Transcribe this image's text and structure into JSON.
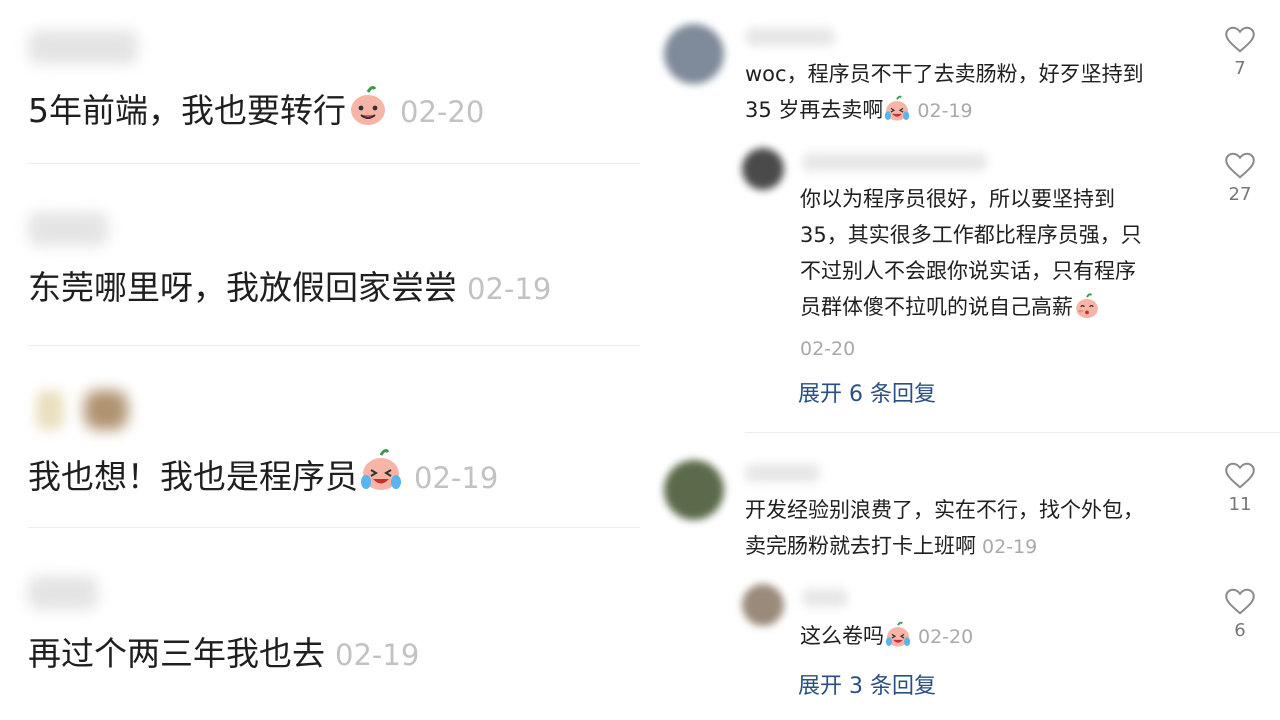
{
  "left_comments": [
    {
      "text": "5年前端，我也要转行",
      "date": "02-20",
      "emoji": "smile"
    },
    {
      "text": "东莞哪里呀，我放假回家尝尝",
      "date": "02-19",
      "emoji": ""
    },
    {
      "text": "我也想！我也是程序员",
      "date": "02-19",
      "emoji": "laugh-cry"
    },
    {
      "text": "再过个两三年我也去",
      "date": "02-19",
      "emoji": ""
    }
  ],
  "right": {
    "comment1": {
      "text_line1": "woc，程序员不干了去卖肠粉，好歹坚持到",
      "text_line2": "35 岁再去卖啊",
      "date": "02-19",
      "likes": "7"
    },
    "reply1": {
      "lines": [
        "你以为程序员很好，所以要坚持到",
        "35，其实很多工作都比程序员强，只",
        "不过别人不会跟你说实话，只有程序",
        "员群体傻不拉叽的说自己高薪"
      ],
      "date": "02-20",
      "likes": "27"
    },
    "expand1": "展开 6 条回复",
    "comment2": {
      "text_line1": "开发经验别浪费了，实在不行，找个外包，",
      "text_line2": "卖完肠粉就去打卡上班啊",
      "date": "02-19",
      "likes": "11"
    },
    "reply2": {
      "text": "这么卷吗",
      "date": "02-20",
      "likes": "6"
    },
    "expand2": "展开 3 条回复"
  },
  "colors": {
    "link": "#2a4f82",
    "timestamp": "#c2c2c2",
    "heart_outline": "#8a8a8a"
  }
}
